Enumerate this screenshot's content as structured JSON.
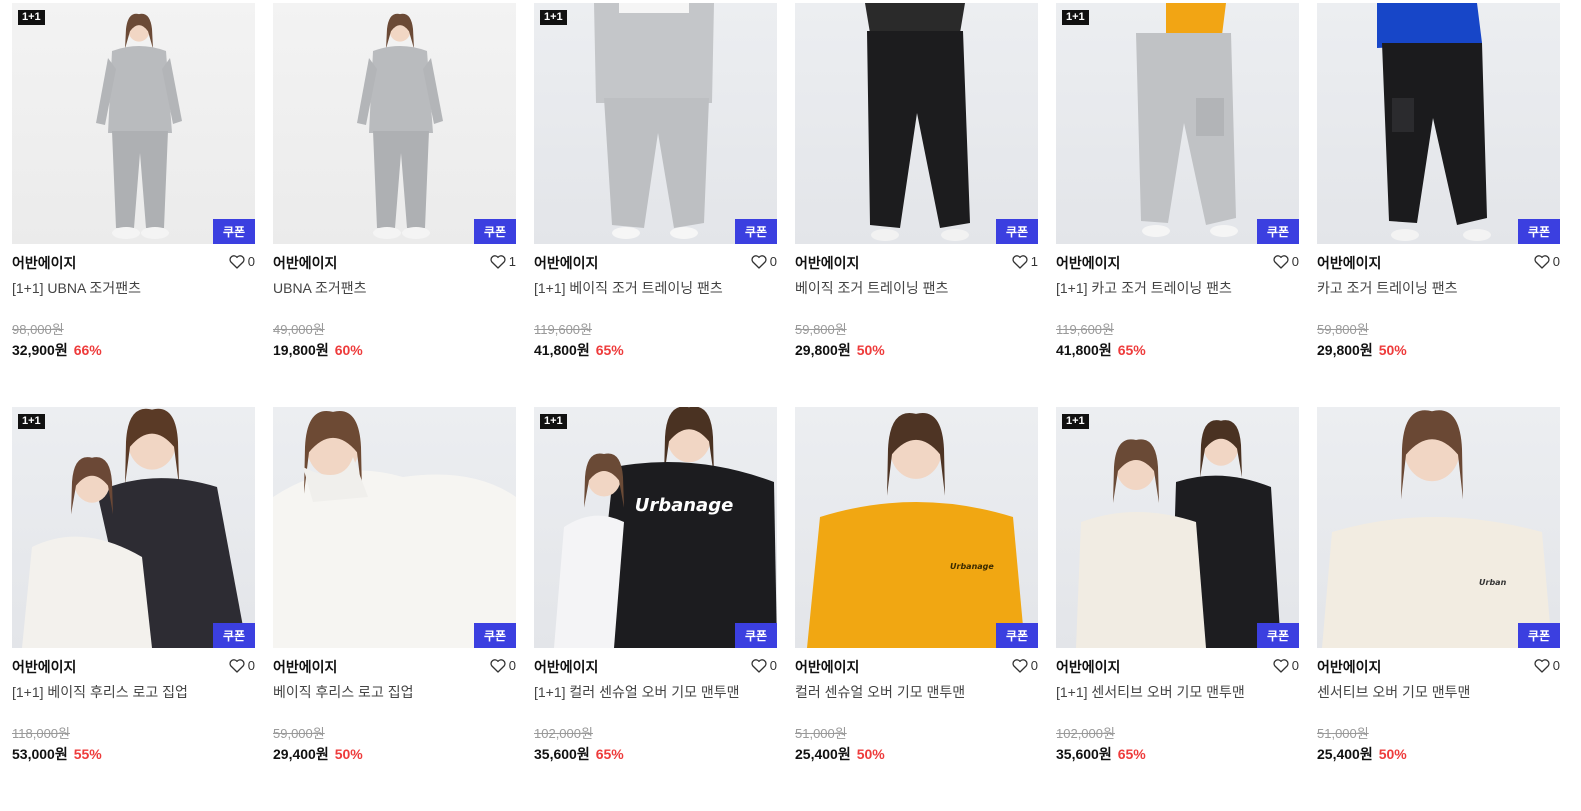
{
  "products": [
    {
      "badge": "1+1",
      "coupon": "쿠폰",
      "brand": "어반에이지",
      "likes": "0",
      "name": "[1+1] UBNA 조거팬츠",
      "original_price": "98,000원",
      "price": "32,900원",
      "discount": "66%",
      "outfit": "gray-set",
      "bg": "light"
    },
    {
      "badge": "",
      "coupon": "쿠폰",
      "brand": "어반에이지",
      "likes": "1",
      "name": "UBNA 조거팬츠",
      "original_price": "49,000원",
      "price": "19,800원",
      "discount": "60%",
      "outfit": "gray-set",
      "bg": "light"
    },
    {
      "badge": "1+1",
      "coupon": "쿠폰",
      "brand": "어반에이지",
      "likes": "0",
      "name": "[1+1] 베이직 조거 트레이닝 팬츠",
      "original_price": "119,600원",
      "price": "41,800원",
      "discount": "65%",
      "outfit": "gray-pants",
      "bg": "cool"
    },
    {
      "badge": "",
      "coupon": "쿠폰",
      "brand": "어반에이지",
      "likes": "1",
      "name": "베이직 조거 트레이닝 팬츠",
      "original_price": "59,800원",
      "price": "29,800원",
      "discount": "50%",
      "outfit": "black-pants",
      "bg": "cool"
    },
    {
      "badge": "1+1",
      "coupon": "쿠폰",
      "brand": "어반에이지",
      "likes": "0",
      "name": "[1+1] 카고 조거 트레이닝 팬츠",
      "original_price": "119,600원",
      "price": "41,800원",
      "discount": "65%",
      "outfit": "gray-cargo",
      "bg": "cool"
    },
    {
      "badge": "",
      "coupon": "쿠폰",
      "brand": "어반에이지",
      "likes": "0",
      "name": "카고 조거 트레이닝 팬츠",
      "original_price": "59,800원",
      "price": "29,800원",
      "discount": "50%",
      "outfit": "black-cargo",
      "bg": "cool"
    },
    {
      "badge": "1+1",
      "coupon": "쿠폰",
      "brand": "어반에이지",
      "likes": "0",
      "name": "[1+1] 베이직 후리스 로고 집업",
      "original_price": "118,000원",
      "price": "53,000원",
      "discount": "55%",
      "outfit": "couple-white-black",
      "bg": "cool"
    },
    {
      "badge": "",
      "coupon": "쿠폰",
      "brand": "어반에이지",
      "likes": "0",
      "name": "베이직 후리스 로고 집업",
      "original_price": "59,000원",
      "price": "29,400원",
      "discount": "50%",
      "outfit": "white-zip",
      "bg": "cool"
    },
    {
      "badge": "1+1",
      "coupon": "쿠폰",
      "brand": "어반에이지",
      "likes": "0",
      "name": "[1+1] 컬러 센슈얼 오버 기모 맨투맨",
      "original_price": "102,000원",
      "price": "35,600원",
      "discount": "65%",
      "outfit": "couple-back",
      "bg": "cool"
    },
    {
      "badge": "",
      "coupon": "쿠폰",
      "brand": "어반에이지",
      "likes": "0",
      "name": "컬러 센슈얼 오버 기모 맨투맨",
      "original_price": "51,000원",
      "price": "25,400원",
      "discount": "50%",
      "outfit": "yellow-sweat",
      "bg": "cool"
    },
    {
      "badge": "1+1",
      "coupon": "쿠폰",
      "brand": "어반에이지",
      "likes": "0",
      "name": "[1+1] 센서티브 오버 기모 맨투맨",
      "original_price": "102,000원",
      "price": "35,600원",
      "discount": "65%",
      "outfit": "couple-cream-black",
      "bg": "cool"
    },
    {
      "badge": "",
      "coupon": "",
      "brand": "어반에이지",
      "likes": "0",
      "name": "센서티브 오버 기모 맨투맨",
      "original_price": "51,000원",
      "price": "25,400원",
      "discount": "50%",
      "outfit": "cream-sweat",
      "bg": "cool"
    }
  ],
  "coupon_last": "쿠폰",
  "colors": {
    "coupon_bg": "#3b3fe0",
    "discount": "#ee3b3b",
    "badge_bg": "#111111"
  },
  "icons": {
    "like": "heart-outline-icon"
  }
}
